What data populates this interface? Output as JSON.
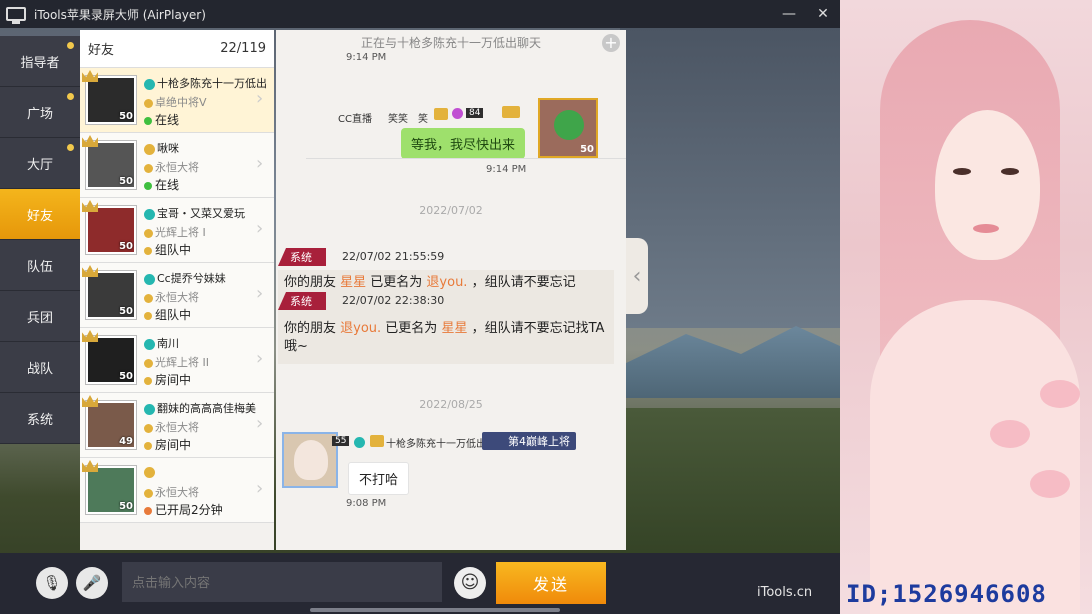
{
  "window": {
    "title": "iTools苹果录屏大师 (AirPlayer)",
    "minimize_glyph": "—",
    "close_glyph": "✕"
  },
  "nav": {
    "items": [
      {
        "label": "指导者",
        "dot": true
      },
      {
        "label": "广场",
        "dot": true
      },
      {
        "label": "大厅",
        "dot": true
      },
      {
        "label": "好友",
        "active": true
      },
      {
        "label": "队伍"
      },
      {
        "label": "兵团"
      },
      {
        "label": "战队"
      },
      {
        "label": "系统"
      }
    ]
  },
  "friends": {
    "title": "好友",
    "count": "22/119",
    "list": [
      {
        "name": "十枪多陈充十一万低出",
        "rank": "卓绝中将V",
        "status": "在线",
        "status_color": "#3fbf3f",
        "level": "50",
        "avatar_color": "#2b2b2b"
      },
      {
        "name": "啾咪",
        "rank": "永恒大将",
        "status": "在线",
        "status_color": "#3fbf3f",
        "level": "50",
        "avatar_color": "#555555"
      },
      {
        "name": "宝哥・又菜又爱玩",
        "rank": "光辉上将 I",
        "status": "组队中",
        "status_color": "#e3b23c",
        "level": "50",
        "avatar_color": "#8e2b2b"
      },
      {
        "name": "Cc提乔兮妹妹",
        "rank": "永恒大将",
        "status": "组队中",
        "status_color": "#e3b23c",
        "level": "50",
        "avatar_color": "#3a3a3a"
      },
      {
        "name": "南川",
        "rank": "光辉上将 II",
        "status": "房间中",
        "status_color": "#e3b23c",
        "level": "50",
        "avatar_color": "#1f1f1f"
      },
      {
        "name": "翻妹的高高高佳梅美",
        "rank": "永恒大将",
        "status": "房间中",
        "status_color": "#e3b23c",
        "level": "49",
        "avatar_color": "#7a5a4a"
      },
      {
        "name": "",
        "rank": "永恒大将",
        "status": "已开局2分钟",
        "status_color": "#e87a3a",
        "level": "50",
        "avatar_color": "#4e7a5a"
      }
    ]
  },
  "chat": {
    "header": "正在与十枪多陈充十一万低出聊天",
    "top_time": "9:14 PM",
    "sender_names": [
      "CC直播",
      "笑笑",
      "笑"
    ],
    "sender_badge_number": "84",
    "self_message": "等我，我尽快出来",
    "self_level": "50",
    "self_time": "9:14 PM",
    "date1": "2022/07/02",
    "system_label": "系统",
    "sys1": {
      "time": "22/07/02 21:55:59",
      "pre": "你的朋友 ",
      "a": "星星",
      "mid": "  已更名为 ",
      "b": "退you.",
      "post": " ，组队请不要忘记"
    },
    "sys2": {
      "time": "22/07/02 22:38:30",
      "pre": "你的朋友 ",
      "a": "退you.",
      "mid": " 已更名为 ",
      "b": "星星",
      "post": "   ，组队请不要忘记找TA哦~"
    },
    "date2": "2022/08/25",
    "friend_name": "十枪多陈充十一万低出",
    "friend_level": "55",
    "friend_rank": "第4巅峰上将",
    "friend_message": "不打哈",
    "friend_time": "9:08 PM"
  },
  "bottom": {
    "input_placeholder": "点击输入内容",
    "send_label": "发送",
    "brand": "iTools.cn"
  },
  "streamer": {
    "id_text": "ID;1526946608"
  },
  "colors": {
    "accent": "#f4b51c",
    "system_tag": "#a8203b",
    "bubble_self": "#9ee06c",
    "highlight_name": "#e87a3a"
  }
}
